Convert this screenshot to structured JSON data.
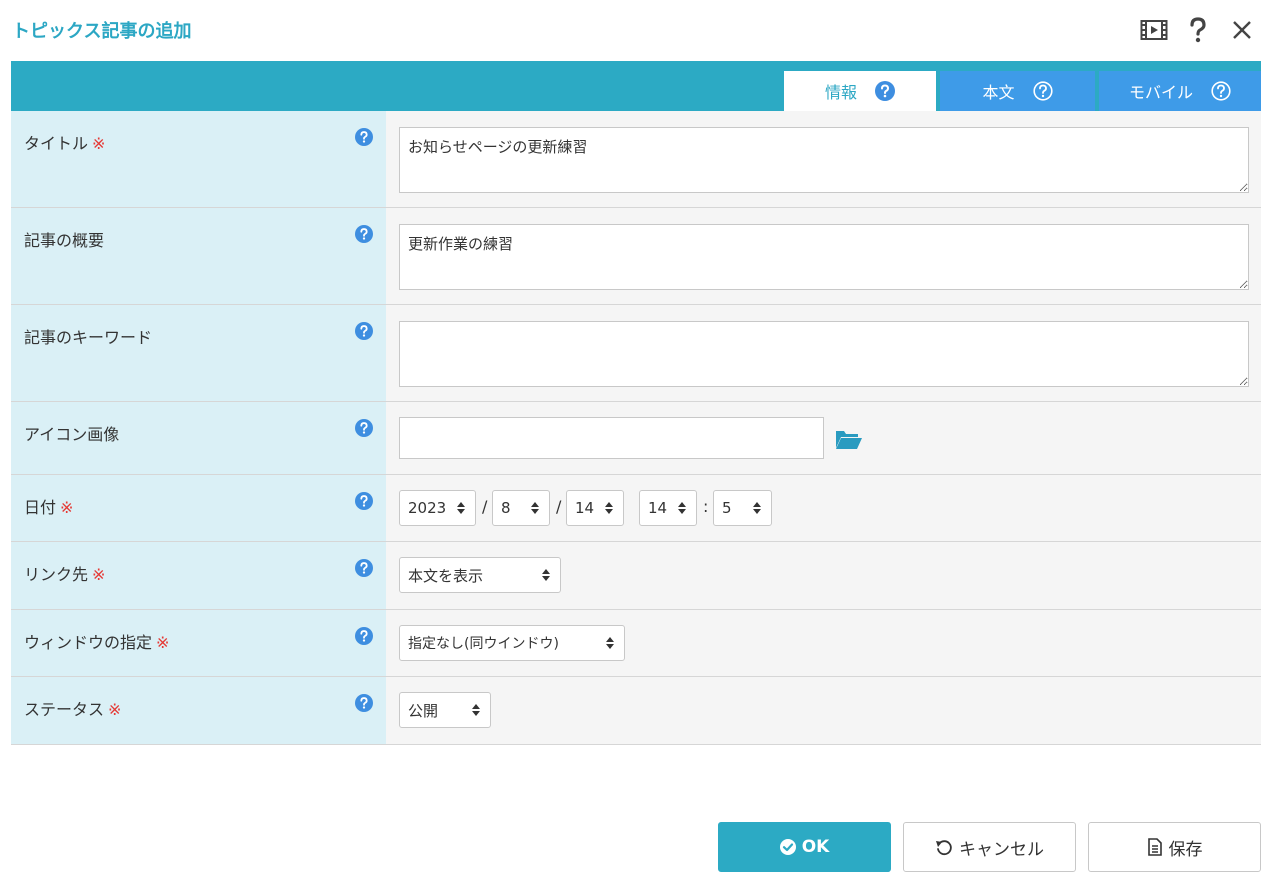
{
  "dialog": {
    "title": "トピックス記事の追加"
  },
  "tabs": [
    {
      "label": "情報",
      "active": true
    },
    {
      "label": "本文",
      "active": false
    },
    {
      "label": "モバイル",
      "active": false
    }
  ],
  "fields": {
    "title": {
      "label": "タイトル",
      "required_mark": "※",
      "value": "お知らせページの更新練習"
    },
    "summary": {
      "label": "記事の概要",
      "value": "更新作業の練習"
    },
    "keywords": {
      "label": "記事のキーワード",
      "value": ""
    },
    "icon_image": {
      "label": "アイコン画像",
      "value": ""
    },
    "date": {
      "label": "日付",
      "required_mark": "※",
      "year": "2023",
      "month": "8",
      "day": "14",
      "hour": "14",
      "minute": "5",
      "sep_slash": "/",
      "sep_colon": ":"
    },
    "link_target": {
      "label": "リンク先",
      "required_mark": "※",
      "value": "本文を表示"
    },
    "window": {
      "label": "ウィンドウの指定",
      "required_mark": "※",
      "value": "指定なし(同ウインドウ)"
    },
    "status": {
      "label": "ステータス",
      "required_mark": "※",
      "value": "公開"
    }
  },
  "buttons": {
    "ok": "OK",
    "cancel": "キャンセル",
    "save": "保存"
  },
  "colors": {
    "accent": "#2caac4",
    "tab_blue": "#3e9be8",
    "label_bg": "#daf0f6",
    "required": "#e53935",
    "help": "#3e8ee0"
  }
}
